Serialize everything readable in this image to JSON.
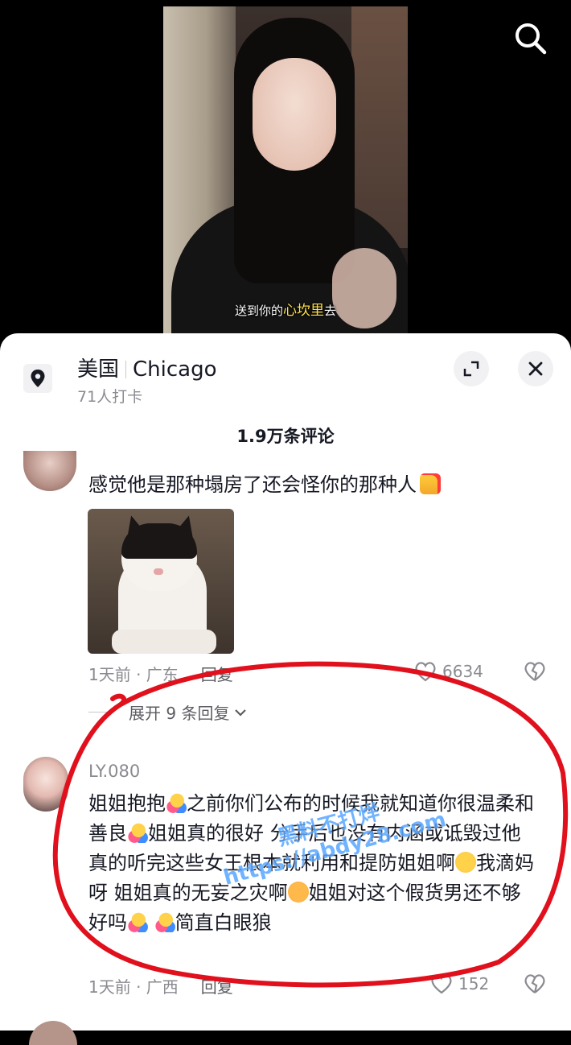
{
  "video": {
    "subtitle_pre": "送到你的",
    "subtitle_highlight": "心坎里",
    "subtitle_post": "去"
  },
  "location": {
    "country": "美国",
    "city": "Chicago",
    "checkins": "71人打卡"
  },
  "comments_header": "1.9万条评论",
  "comments": [
    {
      "text": "感觉他是那种塌房了还会怪你的那种人",
      "emoji": "thumbs-up",
      "meta": "1天前 · 广东",
      "reply_label": "回复",
      "likes": "6634",
      "expand_replies": "展开 9 条回复"
    },
    {
      "username": "LY.080",
      "segments": [
        "姐姐抱抱",
        "之前你们公布的时候我就知道你很温柔和善良",
        "姐姐真的很好 分手后也没有内涵或诋毁过他 真的听完这些女王根本就利用和提防姐姐啊",
        "我滴妈呀 姐姐真的无妄之灾啊",
        "姐姐对这个假货男还不够好吗",
        "简直白眼狼"
      ],
      "meta": "1天前 · 广西",
      "reply_label": "回复",
      "likes": "152"
    }
  ],
  "watermark": {
    "line1": "黑料不打烊",
    "line2": "https://abdy28.com"
  },
  "colors": {
    "circle": "#e0101c",
    "watermark": "#58a6ff",
    "subtitle_highlight": "#ffe14a"
  }
}
